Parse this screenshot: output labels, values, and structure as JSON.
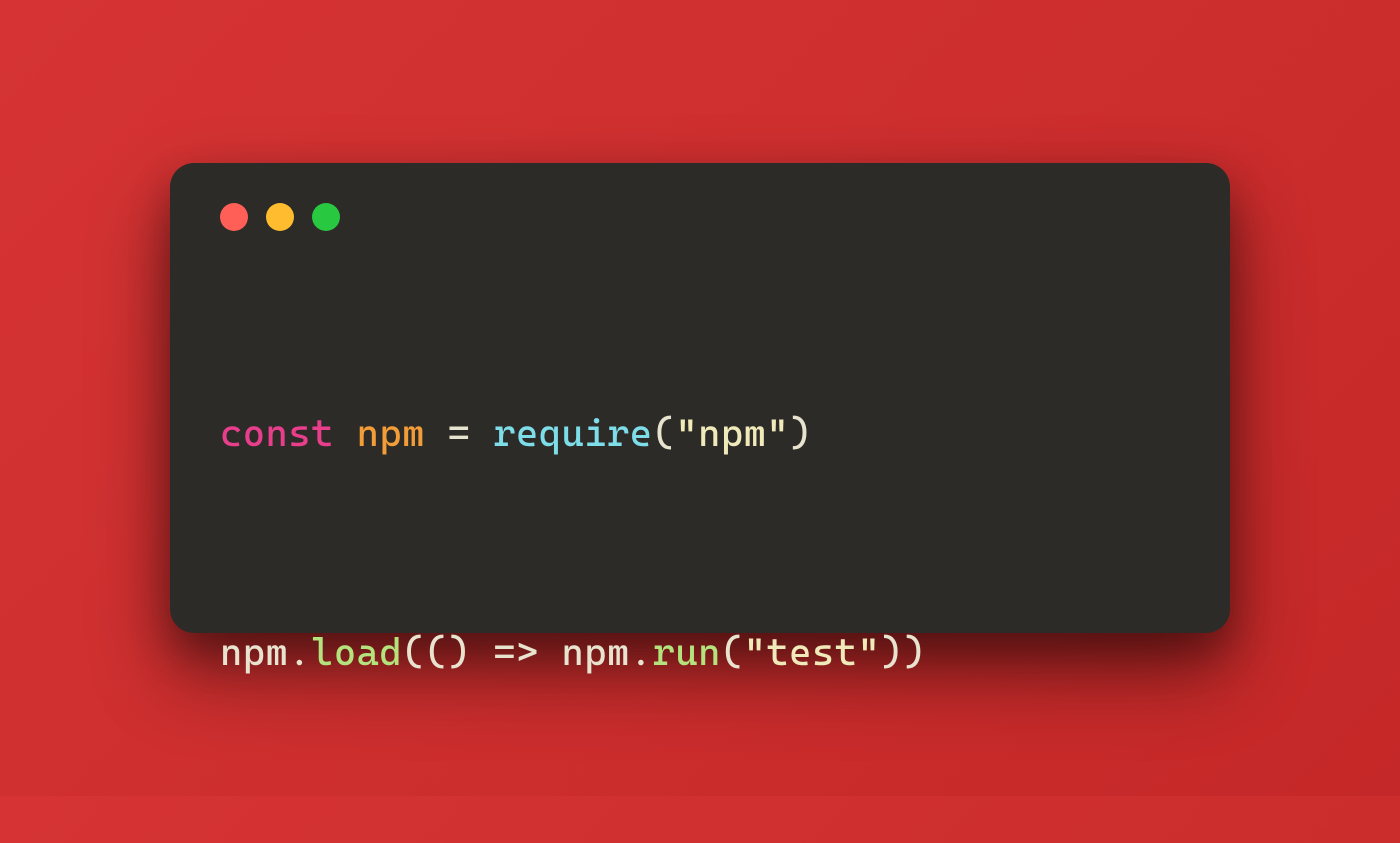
{
  "code": {
    "line1": {
      "keyword": "const",
      "varname": "npm",
      "equals": "=",
      "func": "require",
      "open_paren": "(",
      "string": "\"npm\"",
      "close_paren": ")"
    },
    "line2": {
      "ident1": "npm",
      "dot1": ".",
      "method1": "load",
      "open_paren1": "(",
      "arrow_params": "()",
      "arrow": "=>",
      "ident2": "npm",
      "dot2": ".",
      "method2": "run",
      "open_paren2": "(",
      "string": "\"test\"",
      "close_paren2": ")",
      "close_paren1": ")"
    }
  }
}
